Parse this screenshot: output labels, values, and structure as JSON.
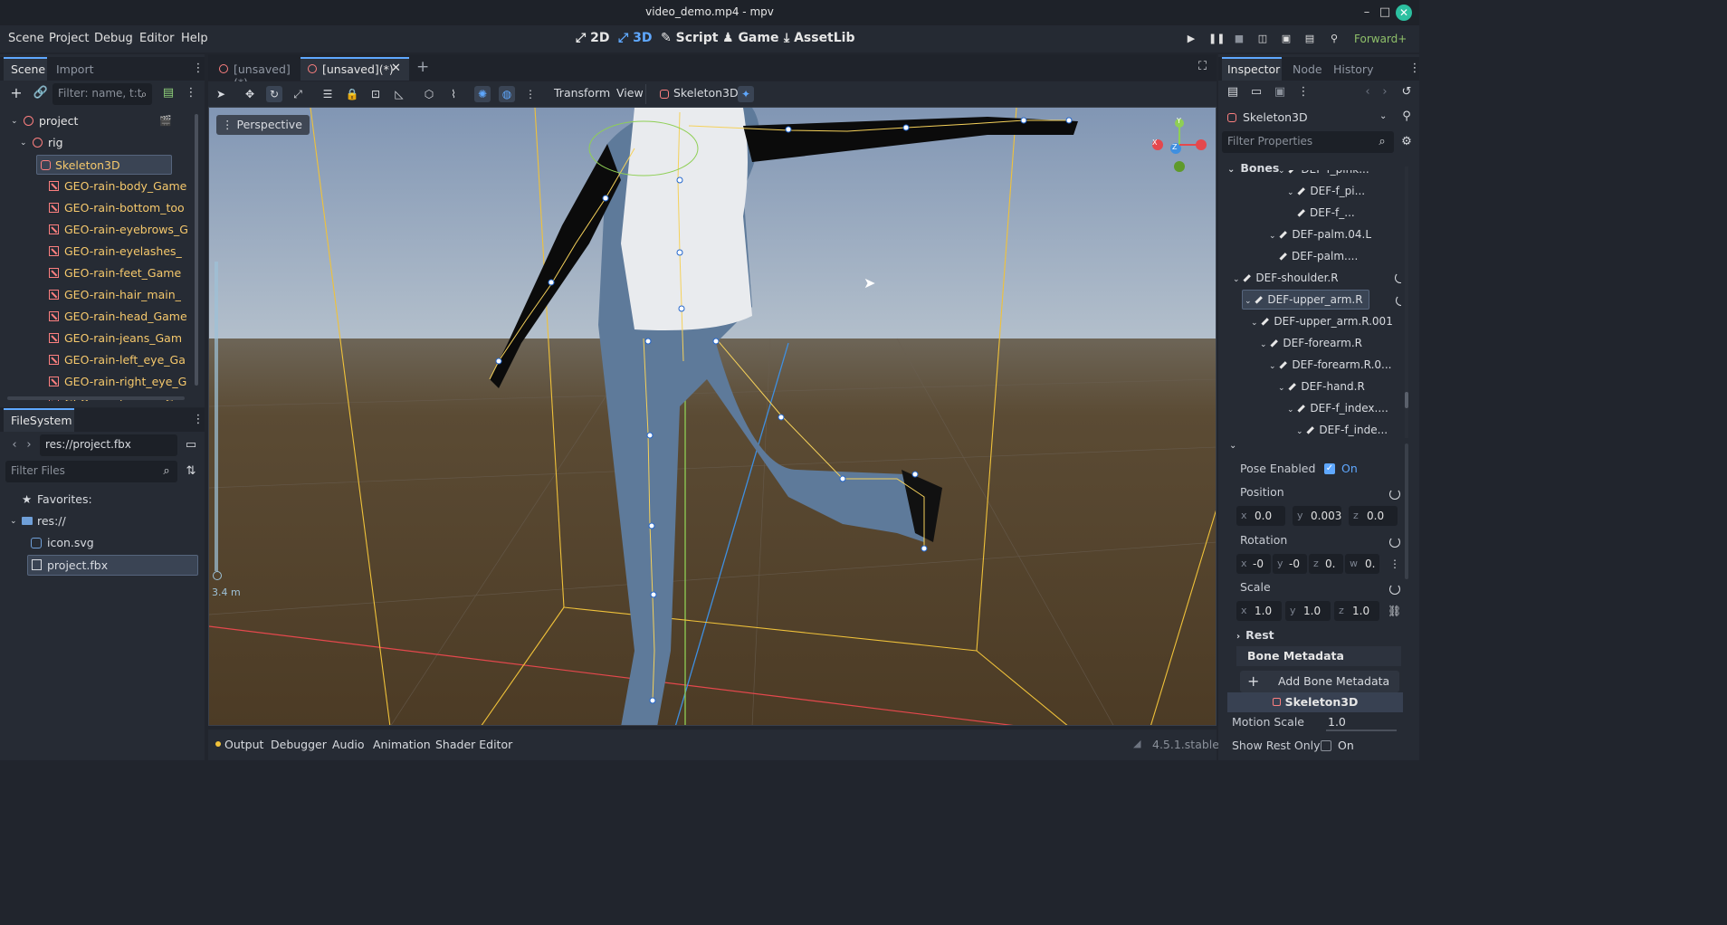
{
  "window": {
    "title": "video_demo.mp4 - mpv"
  },
  "menu": {
    "items": [
      "Scene",
      "Project",
      "Debug",
      "Editor",
      "Help"
    ]
  },
  "workspaces": {
    "w2d": "2D",
    "w3d": "3D",
    "script": "Script",
    "game": "Game",
    "assetlib": "AssetLib"
  },
  "renderer": "Forward+",
  "scene_dock": {
    "tab_scene": "Scene",
    "tab_import": "Import",
    "filter_placeholder": "Filter: name, t:t",
    "nodes": [
      {
        "label": "project",
        "type": "node"
      },
      {
        "label": "rig",
        "type": "node"
      },
      {
        "label": "Skeleton3D",
        "type": "skeleton"
      },
      {
        "label": "GEO-rain-body_Game",
        "type": "mesh"
      },
      {
        "label": "GEO-rain-bottom_too",
        "type": "mesh"
      },
      {
        "label": "GEO-rain-eyebrows_G",
        "type": "mesh"
      },
      {
        "label": "GEO-rain-eyelashes_",
        "type": "mesh"
      },
      {
        "label": "GEO-rain-feet_Game",
        "type": "mesh"
      },
      {
        "label": "GEO-rain-hair_main_",
        "type": "mesh"
      },
      {
        "label": "GEO-rain-head_Game",
        "type": "mesh"
      },
      {
        "label": "GEO-rain-jeans_Gam",
        "type": "mesh"
      },
      {
        "label": "GEO-rain-left_eye_Ga",
        "type": "mesh"
      },
      {
        "label": "GEO-rain-right_eye_G",
        "type": "mesh"
      },
      {
        "label": "GEO-rain-tongue_Ga",
        "type": "mesh"
      }
    ]
  },
  "filesystem": {
    "title": "FileSystem",
    "path": "res://project.fbx",
    "filter_placeholder": "Filter Files",
    "favorites": "Favorites:",
    "root": "res://",
    "files": [
      "icon.svg",
      "project.fbx"
    ]
  },
  "editor_tabs": [
    "[unsaved](*)",
    "[unsaved](*)"
  ],
  "viewport": {
    "menus": {
      "transform": "Transform",
      "view": "View",
      "skeleton": "Skeleton3D"
    },
    "perspective": "Perspective",
    "distance": "3.4 m",
    "gizmo": {
      "x": "X",
      "y": "Y",
      "z": "Z"
    }
  },
  "bottom_tabs": [
    "Output",
    "Debugger",
    "Audio",
    "Animation",
    "Shader Editor"
  ],
  "version": "4.5.1.stable",
  "inspector": {
    "tab_inspector": "Inspector",
    "tab_node": "Node",
    "tab_history": "History",
    "object": "Skeleton3D",
    "filter_placeholder": "Filter Properties",
    "bones_section": "Bones",
    "bones": [
      {
        "label": "DEF-f_pink...",
        "depth": 6,
        "arrow": true
      },
      {
        "label": "DEF-f_pi...",
        "depth": 7,
        "arrow": true
      },
      {
        "label": "DEF-f_...",
        "depth": 8,
        "arrow": false
      },
      {
        "label": "DEF-palm.04.L",
        "depth": 5,
        "arrow": true
      },
      {
        "label": "DEF-palm....",
        "depth": 6,
        "arrow": false
      },
      {
        "label": "DEF-shoulder.R",
        "depth": 1,
        "arrow": true
      },
      {
        "label": "DEF-upper_arm.R",
        "depth": 2,
        "arrow": true
      },
      {
        "label": "DEF-upper_arm.R.001",
        "depth": 3,
        "arrow": true
      },
      {
        "label": "DEF-forearm.R",
        "depth": 4,
        "arrow": true
      },
      {
        "label": "DEF-forearm.R.0...",
        "depth": 5,
        "arrow": true
      },
      {
        "label": "DEF-hand.R",
        "depth": 6,
        "arrow": true
      },
      {
        "label": "DEF-f_index....",
        "depth": 7,
        "arrow": true
      },
      {
        "label": "DEF-f_inde...",
        "depth": 8,
        "arrow": true
      }
    ],
    "pose_enabled": {
      "label": "Pose Enabled",
      "value": "On"
    },
    "position": {
      "label": "Position",
      "x": "0.0",
      "y": "0.003",
      "z": "0.0"
    },
    "rotation": {
      "label": "Rotation",
      "x": "-0",
      "y": "-0",
      "z": "0.",
      "w": "0."
    },
    "scale": {
      "label": "Scale",
      "x": "1.0",
      "y": "1.0",
      "z": "1.0"
    },
    "rest": "Rest",
    "bone_metadata": "Bone Metadata",
    "add_bone_metadata": "Add Bone Metadata",
    "skeleton_section": "Skeleton3D",
    "motion_scale": {
      "label": "Motion Scale",
      "value": "1.0"
    },
    "show_rest_only": {
      "label": "Show Rest Only",
      "value": "On"
    }
  },
  "colors": {
    "accent": "#5fa8ff",
    "node_red": "#fc7f7f",
    "mesh_text": "#f5c86c",
    "viewport_sky": "#9eb1c8",
    "viewport_ground": "#5b4a34"
  }
}
